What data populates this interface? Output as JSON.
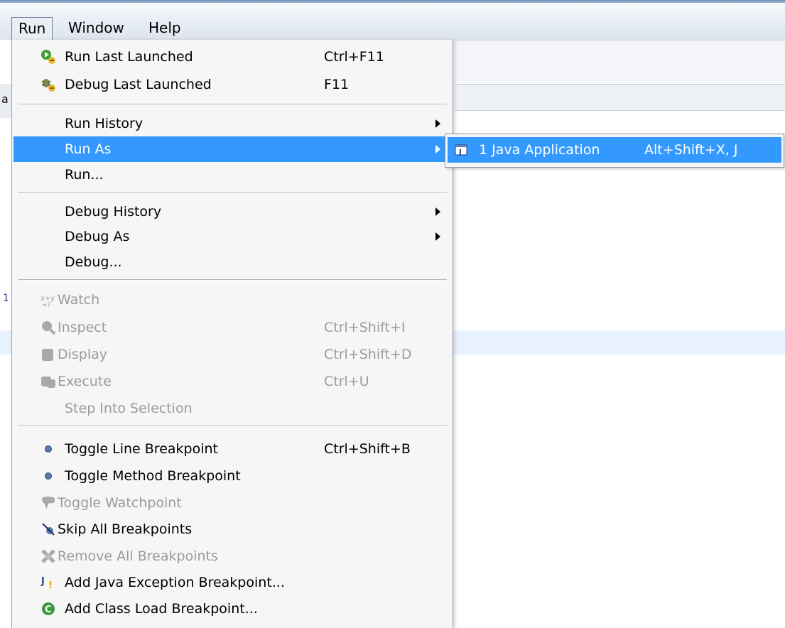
{
  "menubar": {
    "items": [
      "Run",
      "Window",
      "Help"
    ]
  },
  "run_menu": {
    "items": [
      {
        "label": "Run Last Launched",
        "shortcut": "Ctrl+F11",
        "icon": "run-last-icon",
        "enabled": true
      },
      {
        "label": "Debug Last Launched",
        "shortcut": "F11",
        "icon": "debug-last-icon",
        "enabled": true
      },
      {
        "label": "Run History",
        "shortcut": "",
        "submenu": true,
        "enabled": true
      },
      {
        "label": "Run As",
        "shortcut": "",
        "submenu": true,
        "selected": true,
        "enabled": true
      },
      {
        "label": "Run...",
        "shortcut": "",
        "enabled": true
      },
      {
        "label": "Debug History",
        "shortcut": "",
        "submenu": true,
        "enabled": true
      },
      {
        "label": "Debug As",
        "shortcut": "",
        "submenu": true,
        "enabled": true
      },
      {
        "label": "Debug...",
        "shortcut": "",
        "enabled": true
      },
      {
        "label": "Watch",
        "shortcut": "",
        "icon": "watch-expression-icon",
        "enabled": false
      },
      {
        "label": "Inspect",
        "shortcut": "Ctrl+Shift+I",
        "icon": "inspect-icon",
        "enabled": false
      },
      {
        "label": "Display",
        "shortcut": "Ctrl+Shift+D",
        "icon": "display-icon",
        "enabled": false
      },
      {
        "label": "Execute",
        "shortcut": "Ctrl+U",
        "icon": "execute-icon",
        "enabled": false
      },
      {
        "label": "Step Into Selection",
        "shortcut": "",
        "enabled": false
      },
      {
        "label": "Toggle Line Breakpoint",
        "shortcut": "Ctrl+Shift+B",
        "icon": "breakpoint-dot-icon",
        "enabled": true
      },
      {
        "label": "Toggle Method Breakpoint",
        "shortcut": "",
        "icon": "breakpoint-dot-icon",
        "enabled": true
      },
      {
        "label": "Toggle Watchpoint",
        "shortcut": "",
        "icon": "watchpoint-icon",
        "enabled": false
      },
      {
        "label": "Skip All Breakpoints",
        "shortcut": "",
        "icon": "skip-breakpoints-icon",
        "enabled": true
      },
      {
        "label": "Remove All Breakpoints",
        "shortcut": "",
        "icon": "remove-breakpoints-icon",
        "enabled": false
      },
      {
        "label": "Add Java Exception Breakpoint...",
        "shortcut": "",
        "icon": "java-exception-icon",
        "enabled": true
      },
      {
        "label": "Add Class Load Breakpoint...",
        "shortcut": "",
        "icon": "class-load-icon",
        "enabled": true
      }
    ]
  },
  "run_as_submenu": {
    "items": [
      {
        "label": "1 Java Application",
        "shortcut": "Alt+Shift+X, J",
        "icon": "java-application-icon",
        "selected": true
      }
    ]
  },
  "colors": {
    "selection": "#3399ff",
    "menu_background": "#f6f6f6",
    "disabled_text": "#9b9b9b"
  }
}
